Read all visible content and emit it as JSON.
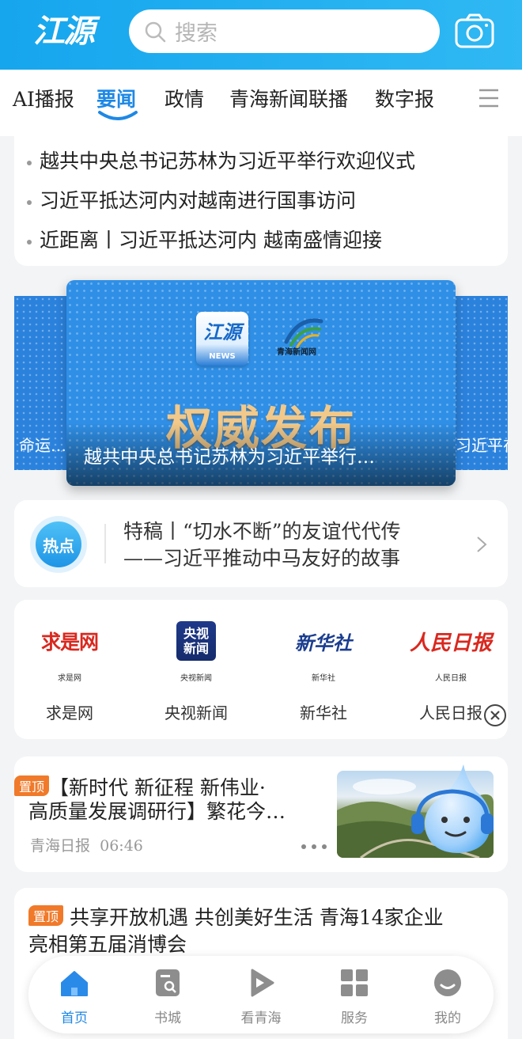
{
  "app": {
    "logo_text": "江源"
  },
  "search": {
    "placeholder": "搜索"
  },
  "tabs": [
    {
      "label": "AI播报"
    },
    {
      "label": "要闻",
      "active": true
    },
    {
      "label": "政情"
    },
    {
      "label": "青海新闻联播"
    },
    {
      "label": "数字报"
    }
  ],
  "headlines": [
    "越共中央总书记苏林为习近平举行欢迎仪式",
    "习近平抵达河内对越南进行国事访问",
    "近距离丨习近平抵达河内 越南盛情迎接"
  ],
  "banner": {
    "news_logo": "江源",
    "news_tag": "NEWS",
    "partner_text": "青海新闻网",
    "title": "权威发布",
    "caption": "越共中央总书记苏林为习近平举行…",
    "left_peek_caption": "命运…",
    "right_peek_caption": "习近平在"
  },
  "hot": {
    "badge": "热点",
    "line1": "特稿丨“切水不断”的友谊代代传",
    "line2": "——习近平推动中马友好的故事"
  },
  "media": [
    {
      "logo_text": "求是网",
      "sub": "求是网",
      "name": "求是网"
    },
    {
      "logo_text": "央视新闻",
      "sub": "央视新闻",
      "name": "央视新闻"
    },
    {
      "logo_text": "新华社",
      "sub": "新华社",
      "name": "新华社"
    },
    {
      "logo_text": "人民日报",
      "sub": "人民日报",
      "name": "人民日报"
    }
  ],
  "news": [
    {
      "pin": "置顶",
      "line1": "【新时代 新征程 新伟业·",
      "line2": "高质量发展调研行】繁花今…",
      "source": "青海日报",
      "time": "06:46"
    },
    {
      "pin": "置顶",
      "line1": "共享开放机遇 共创美好生活 青海14家企业",
      "line2": "亮相第五届消博会"
    }
  ],
  "bottom_nav": [
    {
      "label": "首页",
      "icon": "home-icon",
      "active": true
    },
    {
      "label": "书城",
      "icon": "book-icon"
    },
    {
      "label": "看青海",
      "icon": "play-icon"
    },
    {
      "label": "服务",
      "icon": "grid-icon"
    },
    {
      "label": "我的",
      "icon": "user-icon"
    }
  ],
  "colors": {
    "accent": "#1e88e5",
    "topbar": "#2fb8f3",
    "pin": "#f07a2a"
  }
}
